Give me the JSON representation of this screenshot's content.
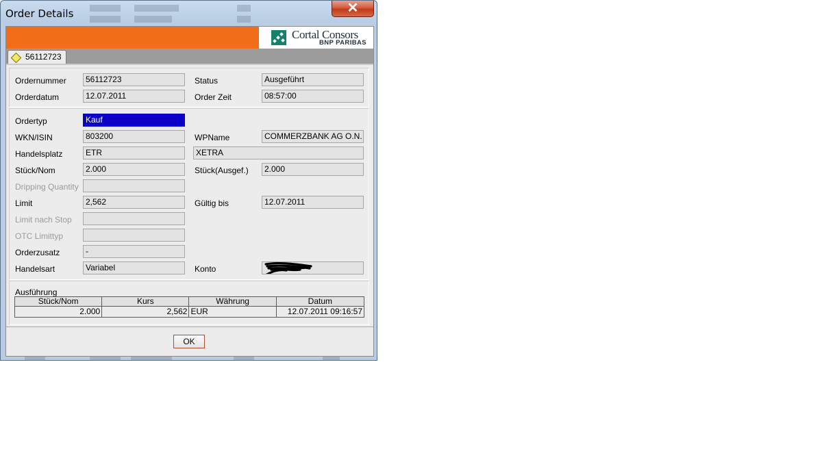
{
  "window": {
    "title": "Order Details",
    "close_glyph": "✕"
  },
  "brand": {
    "name": "Cortal Consors",
    "subline": "BNP PARIBAS",
    "accent": "#f26d1a",
    "logo_color": "#14826b"
  },
  "tab": {
    "label": "56112723",
    "icon": "diamond-icon"
  },
  "header": {
    "ordernummer_label": "Ordernummer",
    "ordernummer_value": "56112723",
    "status_label": "Status",
    "status_value": "Ausgeführt",
    "orderdatum_label": "Orderdatum",
    "orderdatum_value": "12.07.2011",
    "orderzeit_label": "Order Zeit",
    "orderzeit_value": "08:57:00"
  },
  "details": {
    "ordertyp_label": "Ordertyp",
    "ordertyp_value": "Kauf",
    "wkn_label": "WKN/ISIN",
    "wkn_value": "803200",
    "wpname_label": "WPName",
    "wpname_value": "COMMERZBANK AG O.N.",
    "handelsplatz_label": "Handelsplatz",
    "handelsplatz_value": "ETR",
    "handelsplatz_name": "XETRA",
    "stueck_label": "Stück/Nom",
    "stueck_value": "2.000",
    "stueck_ausgef_label": "Stück(Ausgef.)",
    "stueck_ausgef_value": "2.000",
    "dripping_label": "Dripping Quantity",
    "dripping_value": "",
    "limit_label": "Limit",
    "limit_value": "2,562",
    "gueltig_label": "Gültig bis",
    "gueltig_value": "12.07.2011",
    "limit_stop_label": "Limit nach Stop",
    "limit_stop_value": "",
    "otc_label": "OTC Limittyp",
    "otc_value": "",
    "orderzusatz_label": "Orderzusatz",
    "orderzusatz_value": "-",
    "handelsart_label": "Handelsart",
    "handelsart_value": "Variabel",
    "konto_label": "Konto",
    "konto_value": ""
  },
  "execution": {
    "title": "Ausführung",
    "columns": [
      "Stück/Nom",
      "Kurs",
      "Währung",
      "Datum"
    ],
    "rows": [
      [
        "2.000",
        "2,562",
        "EUR",
        "12.07.2011 09:16:57"
      ]
    ]
  },
  "ok_label": "OK"
}
